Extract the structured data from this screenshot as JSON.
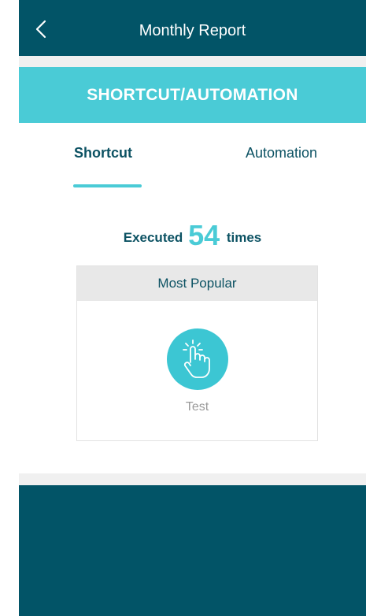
{
  "header": {
    "title": "Monthly Report"
  },
  "section": {
    "title": "SHORTCUT/AUTOMATION"
  },
  "tabs": [
    {
      "label": "Shortcut",
      "active": true
    },
    {
      "label": "Automation",
      "active": false
    }
  ],
  "stats": {
    "prefix": "Executed",
    "count": "54",
    "suffix": "times"
  },
  "popular": {
    "header": "Most Popular",
    "item": {
      "label": "Test",
      "icon": "tap-hand-icon"
    }
  },
  "colors": {
    "nav_bg": "#025467",
    "accent": "#4acbd6",
    "text_dark": "#0c5263"
  }
}
